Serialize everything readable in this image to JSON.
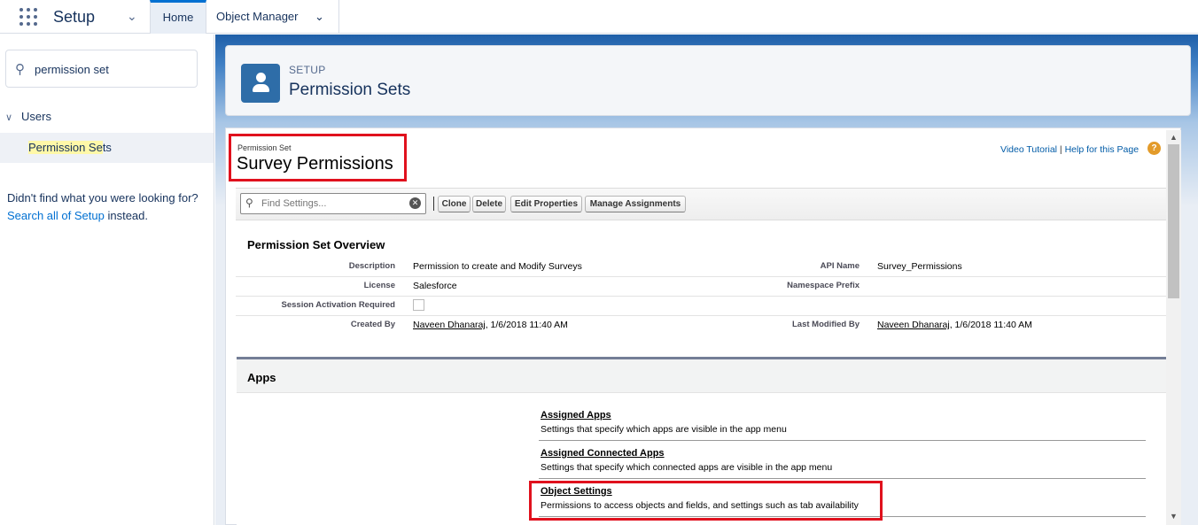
{
  "topnav": {
    "app_name": "Setup",
    "tabs": [
      {
        "label": "Home",
        "active": true
      },
      {
        "label": "Object Manager",
        "active": false
      }
    ]
  },
  "sidebar": {
    "search_value": "permission set",
    "tree": {
      "parent": "Users",
      "child_highlight": "Permission Se",
      "child_rest": "ts"
    },
    "notfound_prefix": "Didn't find what you were looking for? ",
    "notfound_link": "Search all of Setup",
    "notfound_suffix": " instead."
  },
  "page_header": {
    "eyebrow": "SETUP",
    "title": "Permission Sets"
  },
  "permission_set": {
    "label": "Permission Set",
    "name": "Survey Permissions",
    "help": {
      "video": "Video Tutorial",
      "separator": " | ",
      "help_page": "Help for this Page"
    },
    "find_placeholder": "Find Settings...",
    "buttons": {
      "clone": "Clone",
      "delete": "Delete",
      "edit": "Edit Properties",
      "manage": "Manage Assignments"
    }
  },
  "overview": {
    "title": "Permission Set Overview",
    "fields": {
      "description_label": "Description",
      "description_value": "Permission to create and Modify Surveys",
      "api_label": "API Name",
      "api_value": "Survey_Permissions",
      "license_label": "License",
      "license_value": "Salesforce",
      "namespace_label": "Namespace Prefix",
      "namespace_value": "",
      "session_label": "Session Activation Required",
      "session_checked": false,
      "created_label": "Created By",
      "created_user": "Naveen Dhanaraj",
      "created_date": ", 1/6/2018 11:40 AM",
      "modified_label": "Last Modified By",
      "modified_user": "Naveen Dhanaraj",
      "modified_date": ", 1/6/2018 11:40 AM"
    }
  },
  "apps": {
    "title": "Apps",
    "items": [
      {
        "link": "Assigned Apps",
        "desc": "Settings that specify which apps are visible in the app menu"
      },
      {
        "link": "Assigned Connected Apps",
        "desc": "Settings that specify which connected apps are visible in the app menu"
      },
      {
        "link": "Object Settings",
        "desc": "Permissions to access objects and fields, and settings such as tab availability"
      }
    ]
  },
  "colors": {
    "highlight_box": "#e0111d",
    "link_blue": "#0070d2",
    "brand_header": "#2e6da8"
  }
}
